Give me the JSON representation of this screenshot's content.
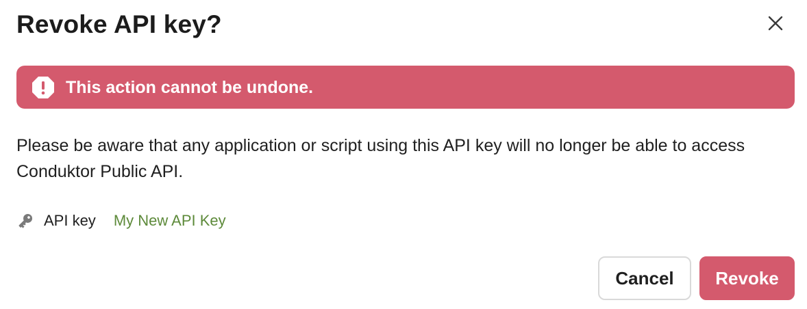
{
  "dialog": {
    "title": "Revoke API key?",
    "close_icon": "close-icon"
  },
  "alert": {
    "icon": "alert-octagon-icon",
    "text": "This action cannot be undone.",
    "color": "#d45a6d"
  },
  "message": "Please be aware that any application or script using this API key will no longer be able to access Conduktor Public API.",
  "key": {
    "icon": "key-icon",
    "label": "API key",
    "value": "My New API Key",
    "value_color": "#5d8a3a"
  },
  "actions": {
    "cancel_label": "Cancel",
    "revoke_label": "Revoke",
    "revoke_color": "#d45a6d"
  }
}
